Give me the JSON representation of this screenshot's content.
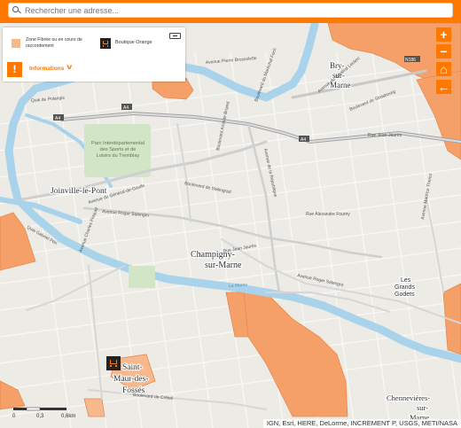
{
  "search": {
    "placeholder": "Rechercher une adresse..."
  },
  "legend": {
    "fibre_label": "Zone Fibrée ou en cours de raccordement",
    "shop_label": "Boutique Orange",
    "info_label": "Informations"
  },
  "controls": {
    "zoom_in": "+",
    "zoom_out": "−",
    "home": "⌂",
    "back": "←",
    "info": "!"
  },
  "scale": {
    "ticks": [
      "0",
      "0,3",
      "0,6km"
    ]
  },
  "attribution": "IGN, Esri, HERE, DeLorme, INCREMENT P, USGS, METI/NASA",
  "map": {
    "places": [
      {
        "id": "bry1",
        "text": "Bry-"
      },
      {
        "id": "bry2",
        "text": "sur-"
      },
      {
        "id": "bry3",
        "text": "Marne"
      },
      {
        "id": "joinville",
        "text": "Joinville-le-Pont"
      },
      {
        "id": "champigny1",
        "text": "Champigny-"
      },
      {
        "id": "champigny2",
        "text": "sur-Marne"
      },
      {
        "id": "stmaur1",
        "text": "Saint-"
      },
      {
        "id": "stmaur2",
        "text": "Maur-des-"
      },
      {
        "id": "stmaur3",
        "text": "Fossés"
      },
      {
        "id": "chennevieres1",
        "text": "Chennevières-"
      },
      {
        "id": "chennevieres2",
        "text": "sur-"
      },
      {
        "id": "chennevieres3",
        "text": "Marne"
      },
      {
        "id": "grandsgodets1",
        "text": "Les"
      },
      {
        "id": "grandsgodets2",
        "text": "Grands"
      },
      {
        "id": "grandsgodets3",
        "text": "Godets"
      }
    ],
    "park": [
      "Parc Interdépartemental",
      "des Sports et de",
      "Loisirs du Tremblay"
    ],
    "roads": [
      {
        "id": "r1",
        "text": "Avenue du Général-de-Gaulle"
      },
      {
        "id": "r2",
        "text": "Avenue Pierre Brossolette"
      },
      {
        "id": "r3",
        "text": "Boulevard de Strasbourg"
      },
      {
        "id": "r4",
        "text": "Boulevard de Stalingrad"
      },
      {
        "id": "r5",
        "text": "Avenue Roger Salengro"
      },
      {
        "id": "r6",
        "text": "Rue Jean-Jaurès"
      },
      {
        "id": "r7",
        "text": "Avenue Maurice Thorez"
      },
      {
        "id": "r8",
        "text": "Avenue de la République"
      },
      {
        "id": "r9",
        "text": "Boulevard Aristide Briand"
      },
      {
        "id": "r10",
        "text": "Boulevard de Créteil"
      },
      {
        "id": "r11",
        "text": "Avenue Charles Floquet"
      },
      {
        "id": "r12",
        "text": "Quai Gabriel Péri"
      },
      {
        "id": "r13",
        "text": "La Marne"
      },
      {
        "id": "r14",
        "text": "Rue Jean Jaurès"
      },
      {
        "id": "r15",
        "text": "Boulevard du Maréchal Foch"
      },
      {
        "id": "r16",
        "text": "Quai de Polangis"
      },
      {
        "id": "r17",
        "text": "Avenue du Général Leclerc"
      },
      {
        "id": "r18",
        "text": "Rue Alexandre Fourny"
      },
      {
        "id": "r19",
        "text": "Avenue Roger Salengro"
      }
    ],
    "shields": [
      "A4",
      "A4",
      "A4",
      "N186"
    ]
  }
}
